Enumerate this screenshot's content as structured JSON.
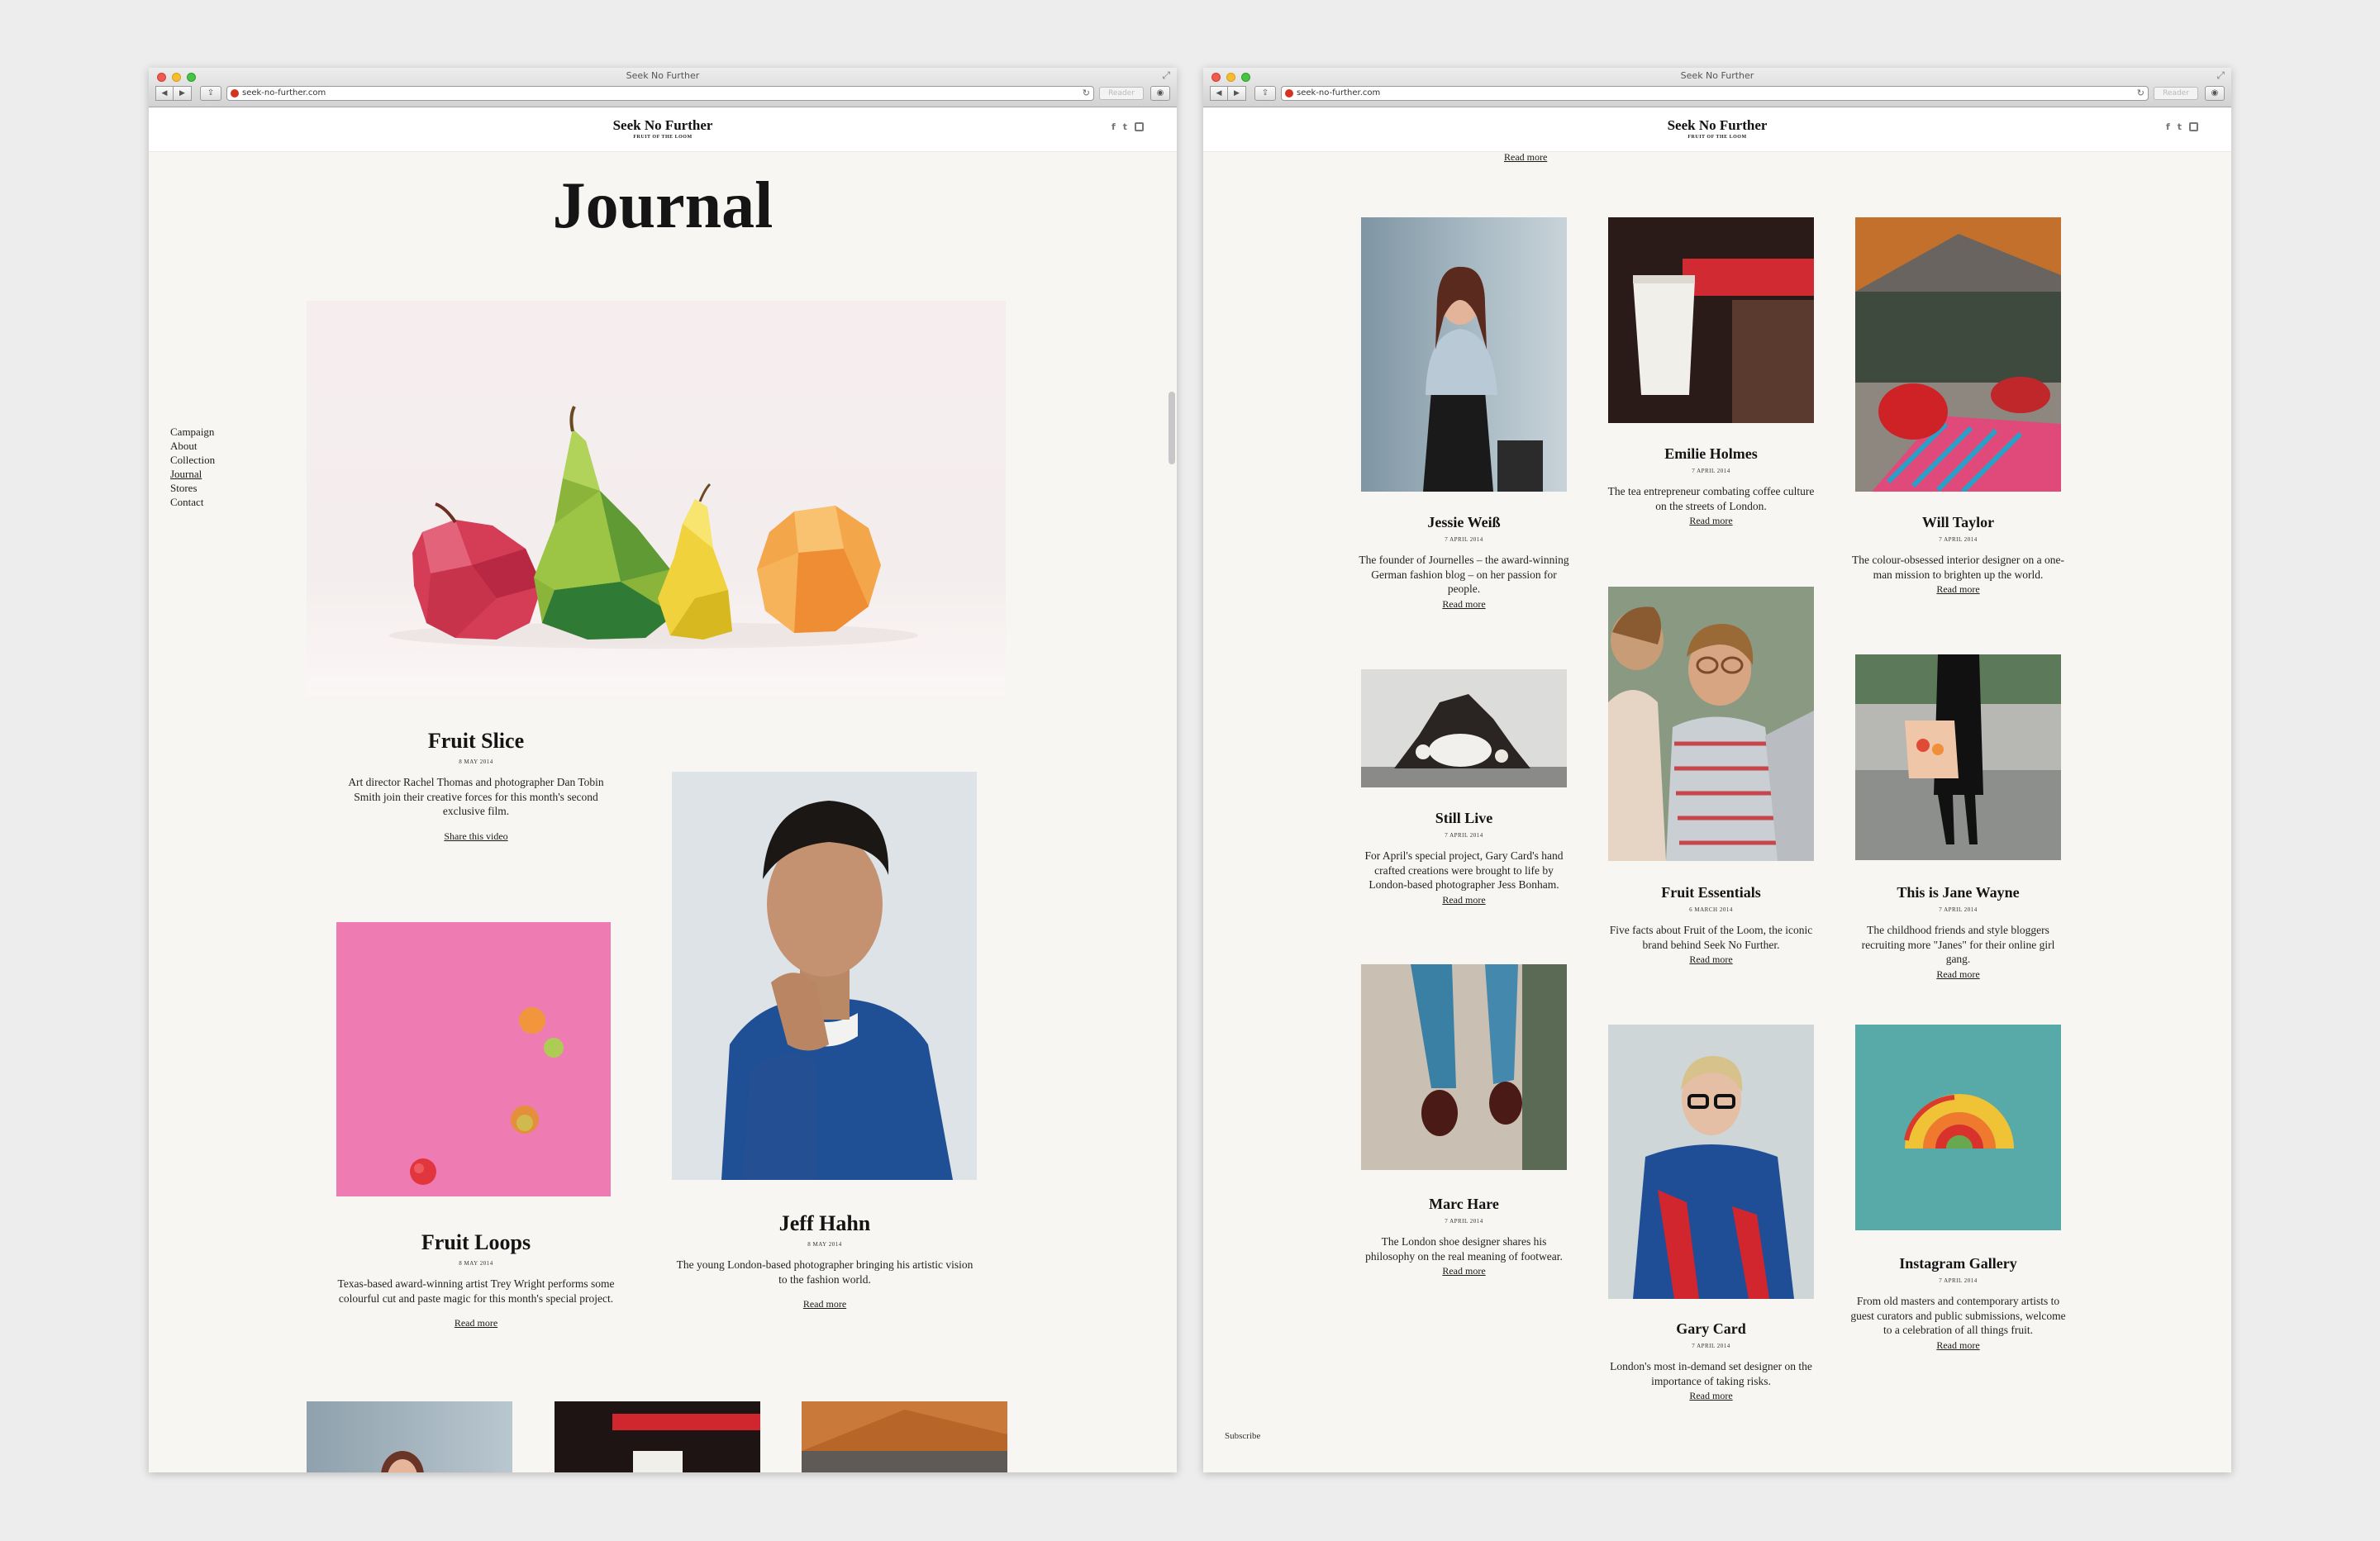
{
  "browser": {
    "window_title": "Seek No Further",
    "url": "seek-no-further.com",
    "reader_label": "Reader",
    "back_glyph": "◀",
    "forward_glyph": "▶",
    "share_glyph": "⇪",
    "reload_glyph": "↻",
    "download_glyph": "◉",
    "expand_glyph": "⤢"
  },
  "site": {
    "name": "Seek No Further",
    "tagline": "FRUIT OF THE LOOM",
    "social_icons": [
      "facebook-icon",
      "twitter-icon",
      "instagram-icon"
    ],
    "facebook_glyph": "f",
    "twitter_glyph": "t"
  },
  "nav": {
    "campaign": "Campaign",
    "about": "About",
    "collection": "Collection",
    "journal": "Journal",
    "stores": "Stores",
    "contact": "Contact"
  },
  "journal": {
    "title": "Journal",
    "fruit_slice": {
      "title": "Fruit Slice",
      "date": "8 MAY 2014",
      "text": "Art director Rachel Thomas and photographer Dan Tobin Smith join their creative forces for this month's second exclusive film.",
      "link": "Share this video"
    },
    "jeff_hahn": {
      "title": "Jeff Hahn",
      "date": "8 MAY 2014",
      "text": "The young London-based photographer bringing his artistic vision to the fashion world.",
      "link": "Read more"
    },
    "fruit_loops": {
      "title": "Fruit Loops",
      "date": "8 MAY 2014",
      "text": "Texas-based award-winning artist Trey Wright performs some colourful cut and paste magic for this month's special project.",
      "link": "Read more"
    }
  },
  "grid": {
    "top_link": "Read more",
    "subscribe": "Subscribe",
    "jessie": {
      "title": "Jessie Weiß",
      "date": "7 APRIL 2014",
      "text": "The founder of Journelles – the award-winning German fashion blog – on her passion for people.",
      "link": "Read more"
    },
    "emilie": {
      "title": "Emilie Holmes",
      "date": "7 APRIL 2014",
      "text": "The tea entrepreneur combating coffee culture on the streets of London.",
      "link": "Read more"
    },
    "will": {
      "title": "Will Taylor",
      "date": "7 APRIL 2014",
      "text": "The colour-obsessed interior designer on a one-man mission to brighten up the world.",
      "link": "Read more"
    },
    "still": {
      "title": "Still Live",
      "date": "7 APRIL 2014",
      "text": "For April's special project, Gary Card's hand crafted creations were brought to life by London-based photographer Jess Bonham.",
      "link": "Read more"
    },
    "essentials": {
      "title": "Fruit Essentials",
      "date": "6 MARCH 2014",
      "text": "Five facts about Fruit of the Loom, the iconic brand behind Seek No Further.",
      "link": "Read more"
    },
    "jane": {
      "title": "This is Jane Wayne",
      "date": "7 APRIL 2014",
      "text": "The childhood friends and style bloggers recruiting more \"Janes\" for their online girl gang.",
      "link": "Read more"
    },
    "marc": {
      "title": "Marc Hare",
      "date": "7 APRIL 2014",
      "text": "The London shoe designer shares his philosophy on the real meaning of footwear.",
      "link": "Read more"
    },
    "gary": {
      "title": "Gary Card",
      "date": "7 APRIL 2014",
      "text": "London's most in-demand set designer on the importance of taking risks.",
      "link": "Read more"
    },
    "instagram": {
      "title": "Instagram Gallery",
      "date": "7 APRIL 2014",
      "text": "From old masters and contemporary artists to guest curators and public submissions, welcome to a celebration of all things fruit.",
      "link": "Read more"
    }
  },
  "colors": {
    "page_bg": "#f8f6f3",
    "desktop_bg": "#ededed",
    "text": "#141414"
  }
}
